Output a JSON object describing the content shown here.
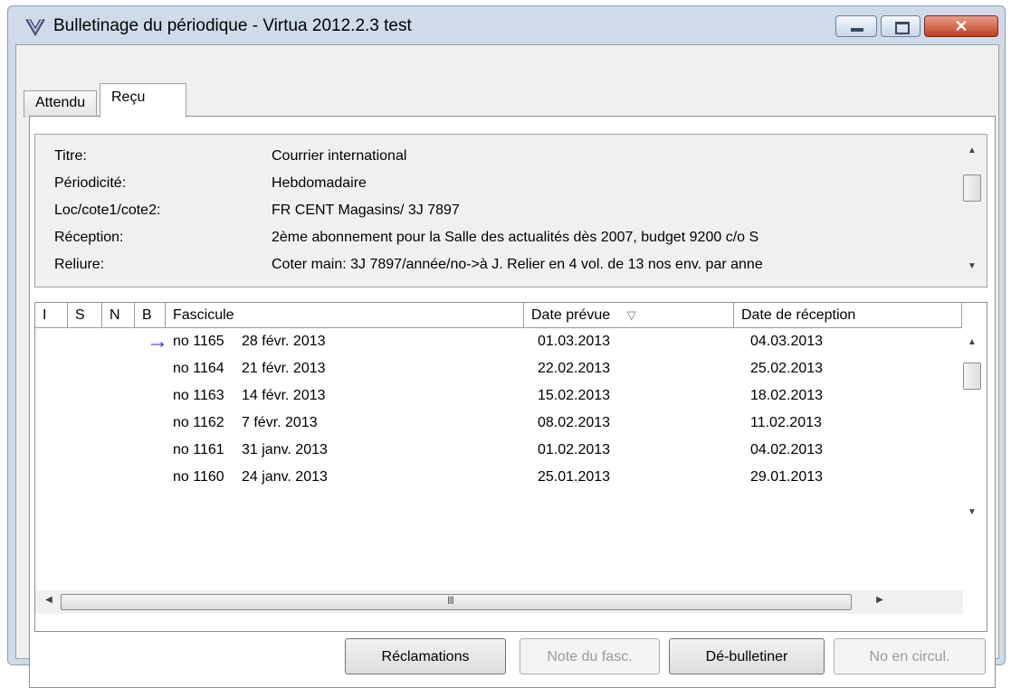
{
  "window": {
    "title": "Bulletinage du périodique - Virtua 2012.2.3 test",
    "close_glyph": "✕"
  },
  "tabs": [
    {
      "label": "Attendu"
    },
    {
      "label": "Reçu"
    }
  ],
  "info": {
    "rows": [
      {
        "label": "Titre:",
        "value": "Courrier international"
      },
      {
        "label": "Périodicité:",
        "value": "Hebdomadaire"
      },
      {
        "label": "Loc/cote1/cote2:",
        "value": "FR CENT Magasins/ 3J 7897"
      },
      {
        "label": "Réception:",
        "value": "2ème abonnement pour la Salle des actualités dès 2007,  budget 9200 c/o S"
      },
      {
        "label": "Reliure:",
        "value": "Coter main: 3J 7897/année/no->à J. Relier en 4 vol. de 13 nos env. par anne"
      }
    ]
  },
  "grid": {
    "columns": [
      "I",
      "S",
      "N",
      "B",
      "Fascicule",
      "Date prévue",
      "Date de réception"
    ],
    "sort_indicator": "▽",
    "selected_marker": "→",
    "rows": [
      {
        "num": "no 1165",
        "date": "28 févr. 2013",
        "expected": "01.03.2013",
        "received": "04.03.2013"
      },
      {
        "num": "no 1164",
        "date": "21 févr. 2013",
        "expected": "22.02.2013",
        "received": "25.02.2013"
      },
      {
        "num": "no 1163",
        "date": "14 févr. 2013",
        "expected": "15.02.2013",
        "received": "18.02.2013"
      },
      {
        "num": "no 1162",
        "date": "7 févr. 2013",
        "expected": "08.02.2013",
        "received": "11.02.2013"
      },
      {
        "num": "no 1161",
        "date": "31 janv. 2013",
        "expected": "01.02.2013",
        "received": "04.02.2013"
      },
      {
        "num": "no 1160",
        "date": "24 janv. 2013",
        "expected": "25.01.2013",
        "received": "29.01.2013"
      }
    ],
    "hscroll_grip": "III"
  },
  "buttons": {
    "claims": "Réclamations",
    "note": "Note du fasc.",
    "unbulletin": "Dé-bulletiner",
    "circ": "No en circul."
  },
  "colors": {
    "arrow": "#1a2cff"
  }
}
